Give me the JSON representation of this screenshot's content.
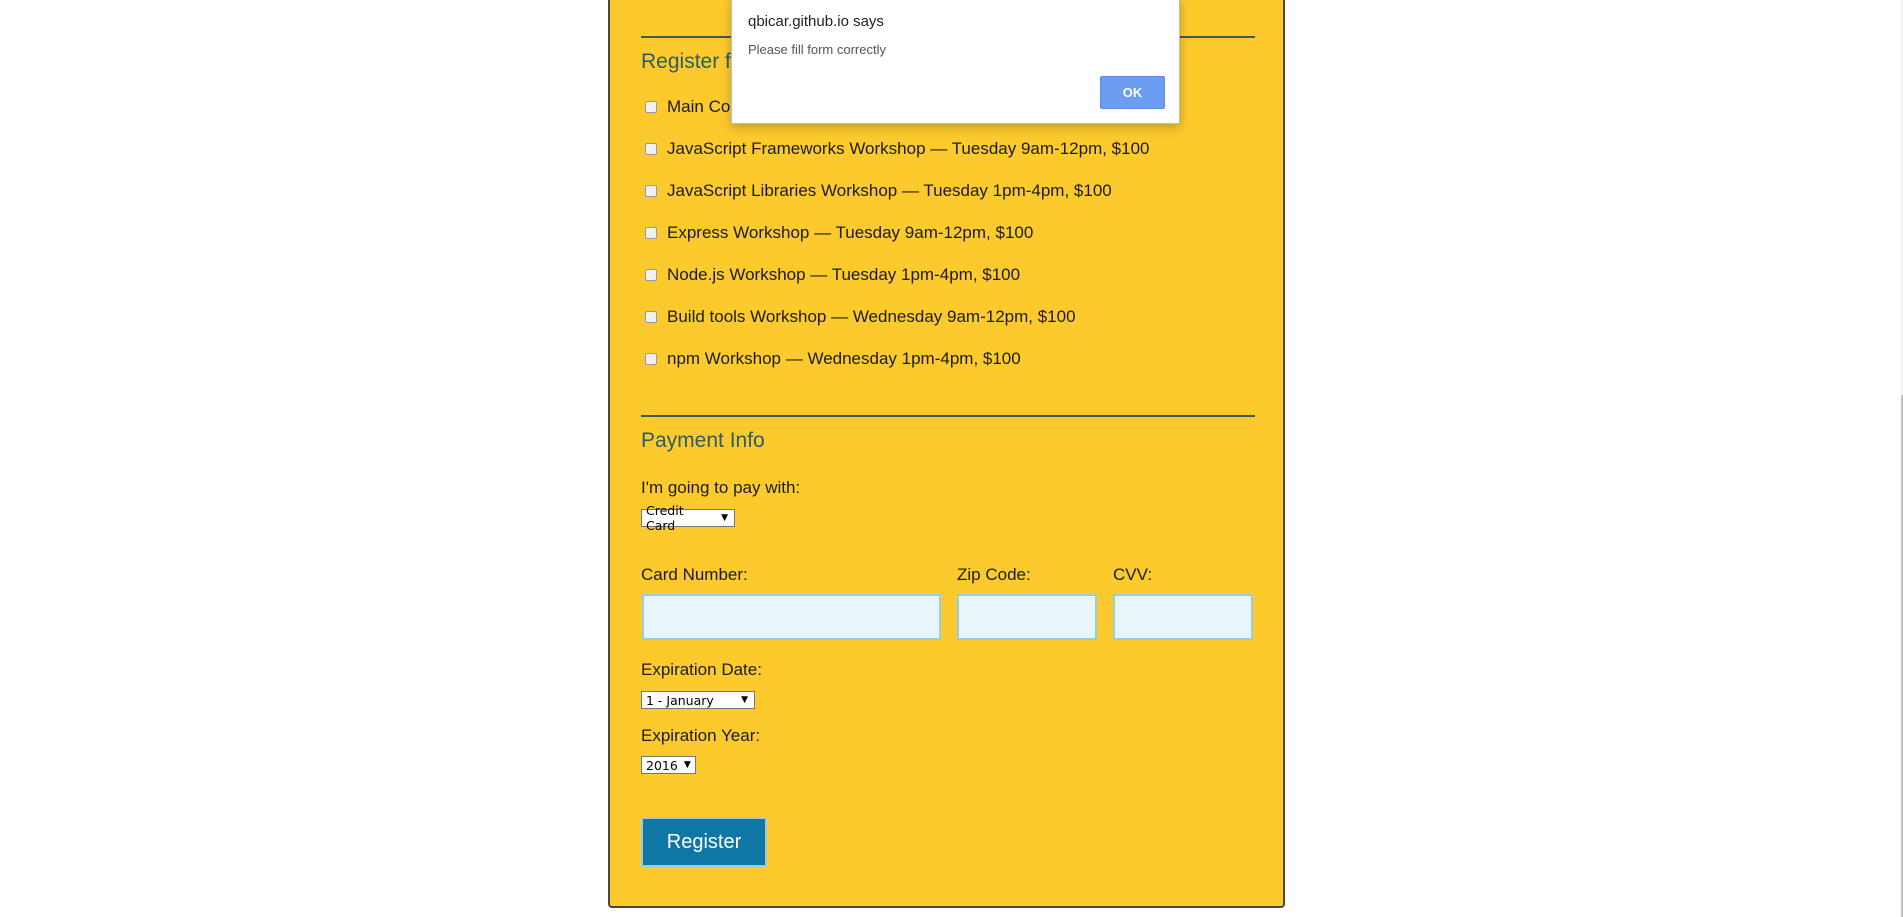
{
  "sections": {
    "register_legend": "Register fo",
    "payment_legend": "Payment Info"
  },
  "activities": [
    {
      "label": "Main Con"
    },
    {
      "label": "JavaScript Frameworks Workshop — Tuesday 9am-12pm, $100"
    },
    {
      "label": "JavaScript Libraries Workshop — Tuesday 1pm-4pm, $100"
    },
    {
      "label": "Express Workshop — Tuesday 9am-12pm, $100"
    },
    {
      "label": "Node.js Workshop — Tuesday 1pm-4pm, $100"
    },
    {
      "label": "Build tools Workshop — Wednesday 9am-12pm, $100"
    },
    {
      "label": "npm Workshop — Wednesday 1pm-4pm, $100"
    }
  ],
  "payment": {
    "pay_with_label": "I'm going to pay with:",
    "method_selected": "Credit Card",
    "card_number_label": "Card Number:",
    "zip_label": "Zip Code:",
    "cvv_label": "CVV:",
    "exp_date_label": "Expiration Date:",
    "exp_date_selected": "1 - January",
    "exp_year_label": "Expiration Year:",
    "exp_year_selected": "2016",
    "card_number_value": "",
    "zip_value": "",
    "cvv_value": ""
  },
  "register_button": "Register",
  "dialog": {
    "title": "qbicar.github.io says",
    "message": "Please fill form correctly",
    "ok": "OK"
  },
  "colors": {
    "card_background": "#fdca2d",
    "legend_text": "#2c5d63",
    "button_primary": "#0e77a4",
    "dialog_ok": "#6b9ef0",
    "input_background": "#e8f6fb"
  }
}
